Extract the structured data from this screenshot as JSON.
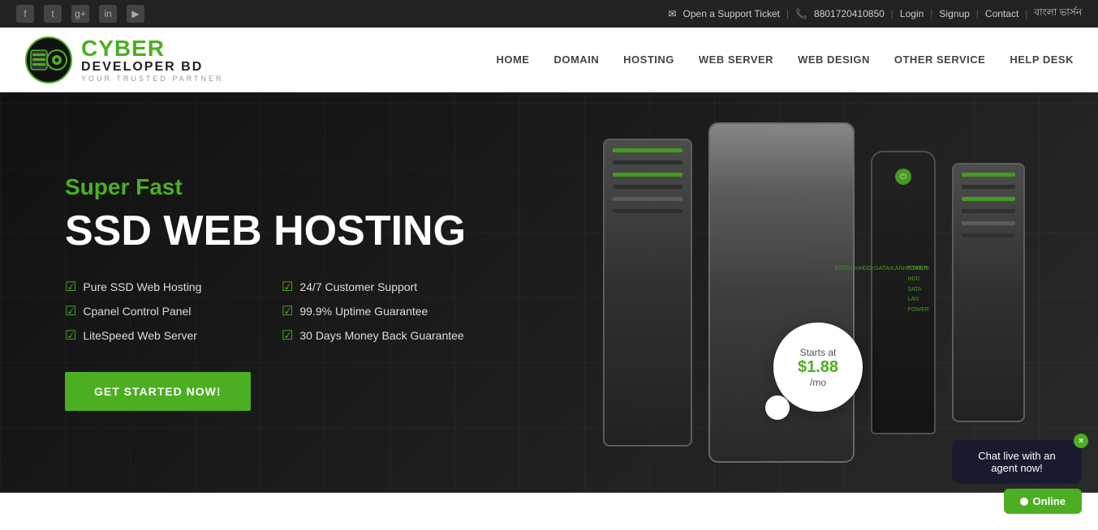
{
  "topbar": {
    "social": [
      {
        "name": "facebook",
        "label": "f"
      },
      {
        "name": "twitter",
        "label": "t"
      },
      {
        "name": "google-plus",
        "label": "g+"
      },
      {
        "name": "linkedin",
        "label": "in"
      },
      {
        "name": "youtube",
        "label": "▶"
      }
    ],
    "support_icon": "✉",
    "support_text": "Open a Support Ticket",
    "phone_icon": "📞",
    "phone": "8801720410850",
    "login": "Login",
    "signup": "Signup",
    "contact": "Contact",
    "bangla": "বাংলা ভার্সন"
  },
  "header": {
    "logo": {
      "cyber": "CYBER",
      "developer": "DEVELOPER BD",
      "tagline": "YOUR TRUSTED PARTNER"
    },
    "nav": [
      {
        "label": "HOME",
        "name": "nav-home"
      },
      {
        "label": "DOMAIN",
        "name": "nav-domain"
      },
      {
        "label": "HOSTING",
        "name": "nav-hosting"
      },
      {
        "label": "WEB SERVER",
        "name": "nav-webserver"
      },
      {
        "label": "WEB DESIGN",
        "name": "nav-webdesign"
      },
      {
        "label": "OTHER SERVICE",
        "name": "nav-otherservice"
      },
      {
        "label": "HELP DESK",
        "name": "nav-helpdesk"
      }
    ]
  },
  "hero": {
    "subtitle": "Super Fast",
    "title": "SSD WEB HOSTING",
    "features": [
      {
        "text": "Pure SSD Web Hosting"
      },
      {
        "text": "24/7 Customer Support"
      },
      {
        "text": "Cpanel Control Panel"
      },
      {
        "text": "99.9% Uptime Guarantee"
      },
      {
        "text": "LiteSpeed Web Server"
      },
      {
        "text": "30 Days Money Back Guarantee"
      }
    ],
    "cta_label": "GET STARTED NOW!",
    "price_starts": "Starts at",
    "price": "$1.88",
    "price_per": "/mo"
  },
  "chat": {
    "bubble_text": "Chat live with an agent now!",
    "online_label": "Online",
    "close_label": "×"
  }
}
